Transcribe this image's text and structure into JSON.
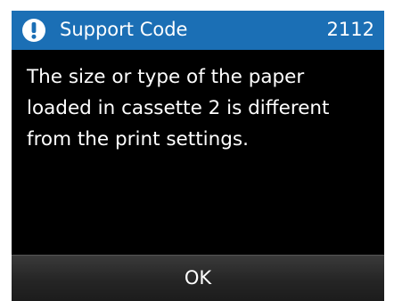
{
  "title_bar": {
    "icon": "exclamation-circle-icon",
    "title": "Support Code",
    "code": "2112",
    "background_color": "#1b6fb5"
  },
  "message": {
    "lines": [
      "The size or type of the paper",
      "loaded in cassette 2 is different",
      "from the print settings."
    ]
  },
  "buttons": {
    "ok_label": "OK"
  }
}
